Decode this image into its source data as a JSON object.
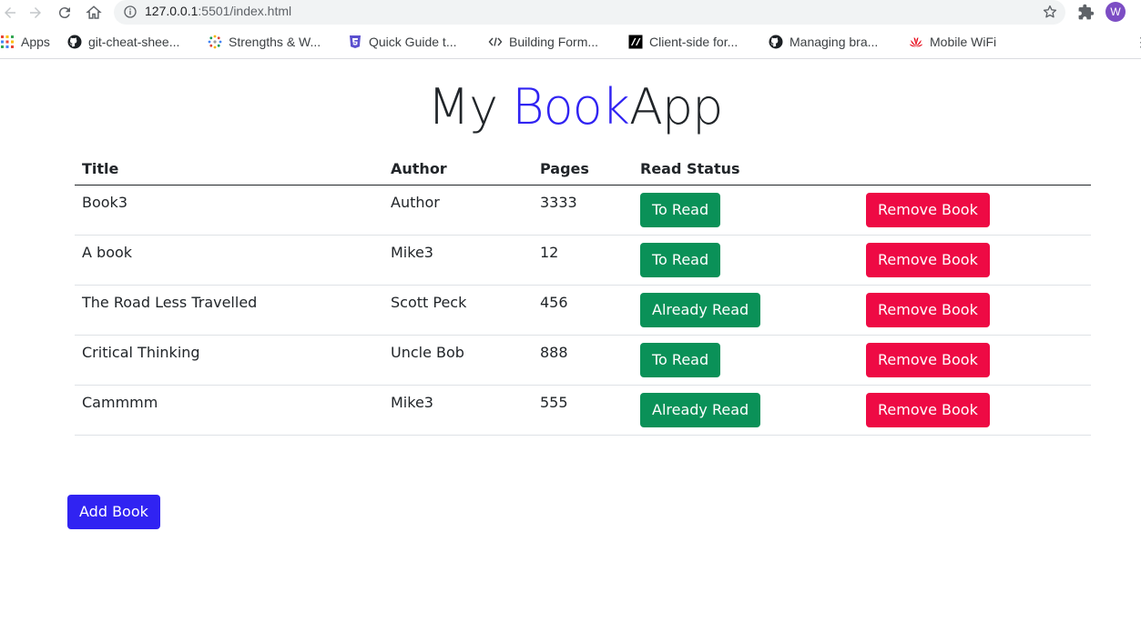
{
  "browser": {
    "url_host": "127.0.0.1",
    "url_rest": ":5501/index.html",
    "avatar_letter": "W",
    "bookmarks": [
      {
        "label": "Apps",
        "icon": "apps-grid-icon"
      },
      {
        "label": "git-cheat-shee...",
        "icon": "github-icon"
      },
      {
        "label": "Strengths & W...",
        "icon": "dots-circle-icon"
      },
      {
        "label": "Quick Guide t...",
        "icon": "html5-icon"
      },
      {
        "label": "Building Form...",
        "icon": "code-icon"
      },
      {
        "label": "Client-side for...",
        "icon": "mdn-icon"
      },
      {
        "label": "Managing bra...",
        "icon": "github-icon"
      },
      {
        "label": "Mobile WiFi",
        "icon": "huawei-icon"
      }
    ]
  },
  "header": {
    "title_part1": "My ",
    "title_accent": "Book",
    "title_part2": "App",
    "accent_color": "#3023f2"
  },
  "table": {
    "headers": [
      "Title",
      "Author",
      "Pages",
      "Read Status",
      ""
    ],
    "rows": [
      {
        "title": "Book3",
        "author": "Author",
        "pages": "3333",
        "status": "To Read",
        "remove": "Remove Book"
      },
      {
        "title": "A book",
        "author": "Mike3",
        "pages": "12",
        "status": "To Read",
        "remove": "Remove Book"
      },
      {
        "title": "The Road Less Travelled",
        "author": "Scott Peck",
        "pages": "456",
        "status": "Already Read",
        "remove": "Remove Book"
      },
      {
        "title": "Critical Thinking",
        "author": "Uncle Bob",
        "pages": "888",
        "status": "To Read",
        "remove": "Remove Book"
      },
      {
        "title": "Cammmm",
        "author": "Mike3",
        "pages": "555",
        "status": "Already Read",
        "remove": "Remove Book"
      }
    ]
  },
  "add_button_label": "Add Book",
  "colors": {
    "status_button": "#0a9158",
    "remove_button": "#ee0a44",
    "add_button": "#3023f2"
  }
}
